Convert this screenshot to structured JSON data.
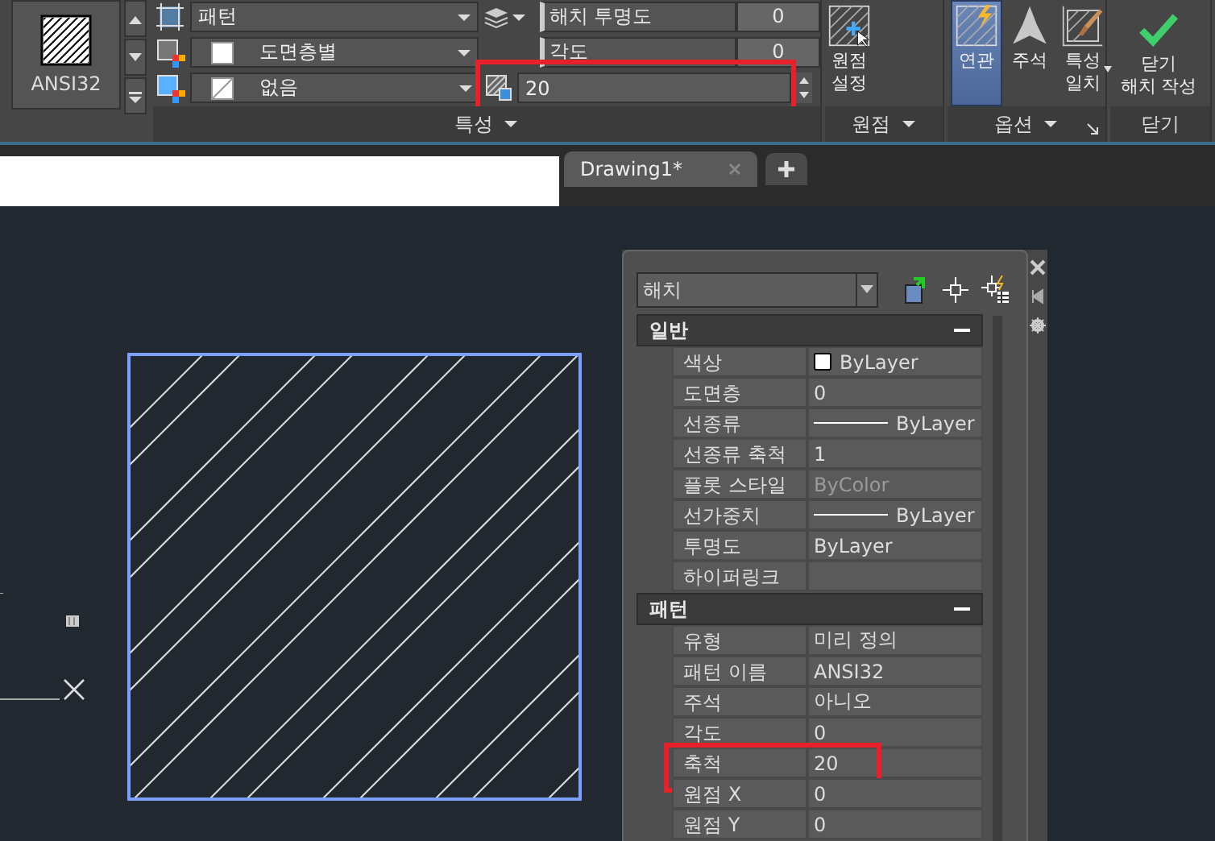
{
  "ribbon": {
    "gallery": {
      "label": "ANSI32"
    },
    "properties": {
      "title": "특성",
      "rows": [
        {
          "dropdown": {
            "kind": "pattern",
            "value": "패턴"
          },
          "field": {
            "kind": "labeled",
            "label": "해치 투명도",
            "value": "0"
          }
        },
        {
          "dropdown": {
            "kind": "color",
            "value": "도면층별"
          },
          "field": {
            "kind": "labeled",
            "label": "각도",
            "value": "0"
          }
        },
        {
          "dropdown": {
            "kind": "background",
            "value": "없음"
          },
          "field": {
            "kind": "spin",
            "value": "20",
            "highlighted": true
          }
        }
      ]
    },
    "origin": {
      "title": "원점",
      "button": {
        "lines": [
          "원점",
          "설정"
        ]
      }
    },
    "options": {
      "title": "옵션",
      "buttons": [
        {
          "kind": "associative",
          "lines": [
            "연관"
          ],
          "selected": true
        },
        {
          "kind": "annotative",
          "lines": [
            "주석"
          ],
          "selected": false
        },
        {
          "kind": "match",
          "lines": [
            "특성",
            "일치"
          ],
          "selected": false,
          "menu": true
        }
      ]
    },
    "close": {
      "title": "닫기",
      "button": {
        "lines": [
          "닫기",
          "해치 작성"
        ]
      }
    }
  },
  "tabs": [
    {
      "label": "Drawing1*",
      "selected": true
    }
  ],
  "palette": {
    "object_type": "해치",
    "sections": [
      {
        "title": "일반",
        "expanded": true,
        "rows": [
          {
            "label": "색상",
            "value": "ByLayer",
            "kind": "swatch",
            "disabled": false
          },
          {
            "label": "도면층",
            "value": "0",
            "kind": "text",
            "disabled": false
          },
          {
            "label": "선종류",
            "value": "ByLayer",
            "kind": "line",
            "disabled": false
          },
          {
            "label": "선종류 축척",
            "value": "1",
            "kind": "text",
            "disabled": false
          },
          {
            "label": "플롯 스타일",
            "value": "ByColor",
            "kind": "text",
            "disabled": true
          },
          {
            "label": "선가중치",
            "value": "ByLayer",
            "kind": "line",
            "disabled": false
          },
          {
            "label": "투명도",
            "value": "ByLayer",
            "kind": "text",
            "disabled": false
          },
          {
            "label": "하이퍼링크",
            "kind": "text",
            "disabled": false
          }
        ]
      },
      {
        "title": "패턴",
        "expanded": true,
        "rows": [
          {
            "label": "유형",
            "value": "미리 정의",
            "kind": "text",
            "disabled": false
          },
          {
            "label": "패턴 이름",
            "value": "ANSI32",
            "kind": "text",
            "disabled": false
          },
          {
            "label": "주석",
            "value": "아니오",
            "kind": "text",
            "disabled": false
          },
          {
            "label": "각도",
            "value": "0",
            "kind": "text",
            "disabled": false
          },
          {
            "label": "축척",
            "value": "20",
            "kind": "text",
            "disabled": false,
            "highlighted": true
          },
          {
            "label": "원점 X",
            "value": "0",
            "kind": "text",
            "disabled": false
          },
          {
            "label": "원점 Y",
            "value": "0",
            "kind": "text",
            "disabled": false
          }
        ]
      }
    ]
  }
}
